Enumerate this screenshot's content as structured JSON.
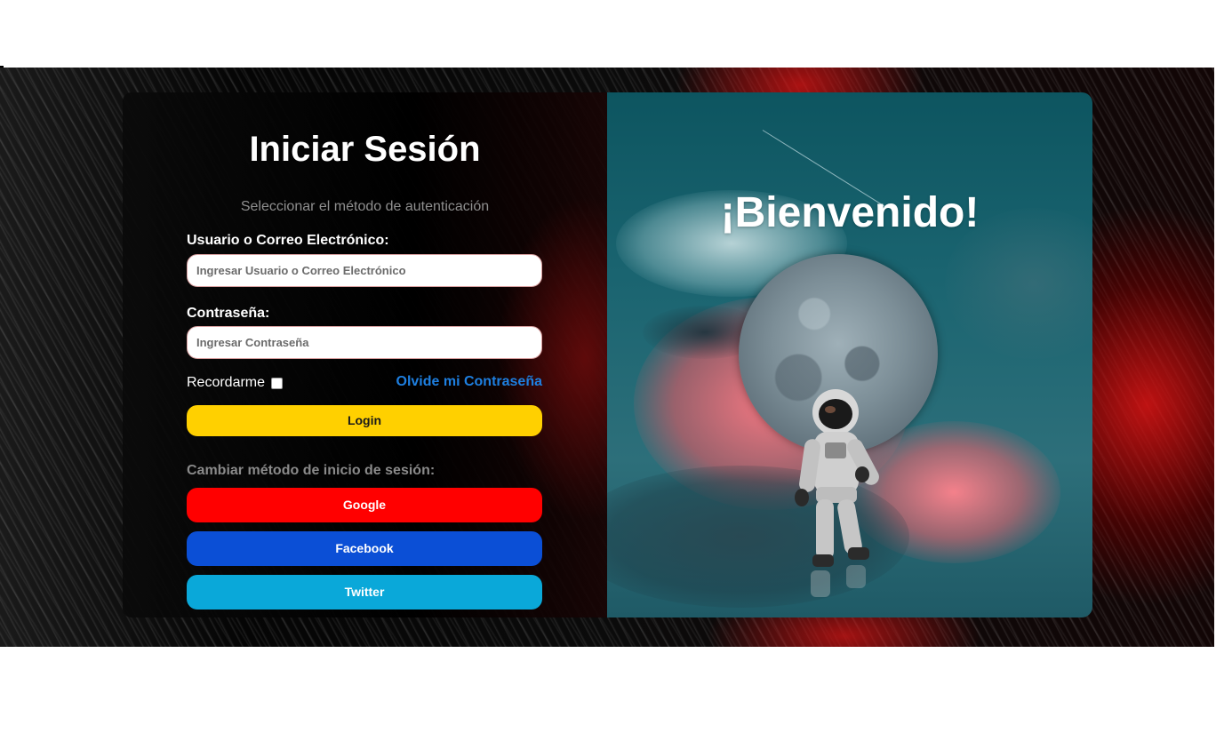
{
  "login": {
    "title": "Iniciar Sesión",
    "subtitle": "Seleccionar el método de autenticación",
    "username_label": "Usuario o Correo Electrónico:",
    "username_placeholder": "Ingresar Usuario o Correo Electrónico",
    "username_value": "",
    "password_label": "Contraseña:",
    "password_placeholder": "Ingresar Contraseña",
    "password_value": "",
    "remember_label": "Recordarme",
    "remember_checked": false,
    "forgot_label": "Olvide mi Contraseña",
    "login_button": "Login",
    "change_method_label": "Cambiar método de inicio de sesión:",
    "social": {
      "google": "Google",
      "facebook": "Facebook",
      "twitter": "Twitter"
    }
  },
  "welcome": {
    "title": "¡Bienvenido!"
  },
  "colors": {
    "login_button": "#ffd000",
    "google": "#ff0000",
    "facebook": "#0b4fd6",
    "twitter": "#0aa8d9",
    "forgot_link": "#1e7fe0"
  }
}
